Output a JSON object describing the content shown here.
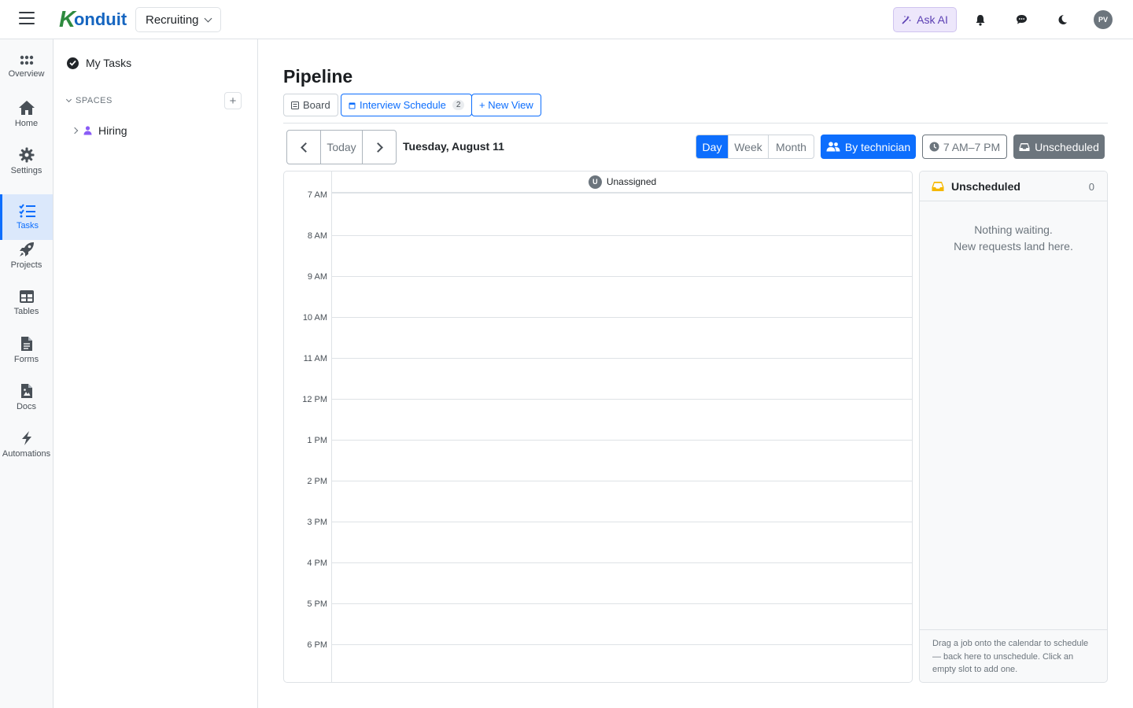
{
  "topbar": {
    "logo_k": "K",
    "logo_rest": "onduit",
    "workspace": "Recruiting",
    "ask_ai": "Ask AI",
    "avatar": "PV"
  },
  "rail": {
    "items": [
      {
        "label": "Overview",
        "icon": "grid-icon"
      },
      {
        "label": "Home",
        "icon": "home-icon"
      },
      {
        "label": "Settings",
        "icon": "gear-icon"
      },
      {
        "label": "Tasks",
        "icon": "tasks-icon",
        "active": true
      },
      {
        "label": "Projects",
        "icon": "rocket-icon"
      },
      {
        "label": "Tables",
        "icon": "table-icon"
      },
      {
        "label": "Forms",
        "icon": "form-icon"
      },
      {
        "label": "Docs",
        "icon": "doc-icon"
      },
      {
        "label": "Automations",
        "icon": "bolt-icon"
      }
    ]
  },
  "sidebar": {
    "my_tasks": "My Tasks",
    "spaces_header": "SPACES",
    "spaces": [
      {
        "label": "Hiring"
      }
    ]
  },
  "main": {
    "title": "Pipeline",
    "views": {
      "board": "Board",
      "interview": "Interview Schedule",
      "interview_count": "2",
      "new_view": "+ New View"
    },
    "toolbar": {
      "today": "Today",
      "date": "Tuesday, August 11",
      "day": "Day",
      "week": "Week",
      "month": "Month",
      "by_technician": "By technician",
      "hours": "7 AM–7 PM",
      "unscheduled": "Unscheduled"
    },
    "calendar": {
      "column_header": "Unassigned",
      "column_initial": "U",
      "hours": [
        "7 AM",
        "8 AM",
        "9 AM",
        "10 AM",
        "11 AM",
        "12 PM",
        "1 PM",
        "2 PM",
        "3 PM",
        "4 PM",
        "5 PM",
        "6 PM"
      ]
    },
    "unscheduled_panel": {
      "title": "Unscheduled",
      "count": "0",
      "empty_line1": "Nothing waiting.",
      "empty_line2": "New requests land here.",
      "footer": "Drag a job onto the calendar to schedule — back here to unschedule. Click an empty slot to add one."
    }
  },
  "colors": {
    "accent": "#0d6efd",
    "secondary": "#6c757d",
    "ai_bg": "#ede7fb",
    "inbox_icon": "#f5b800",
    "space_icon": "#8a5cf6"
  }
}
